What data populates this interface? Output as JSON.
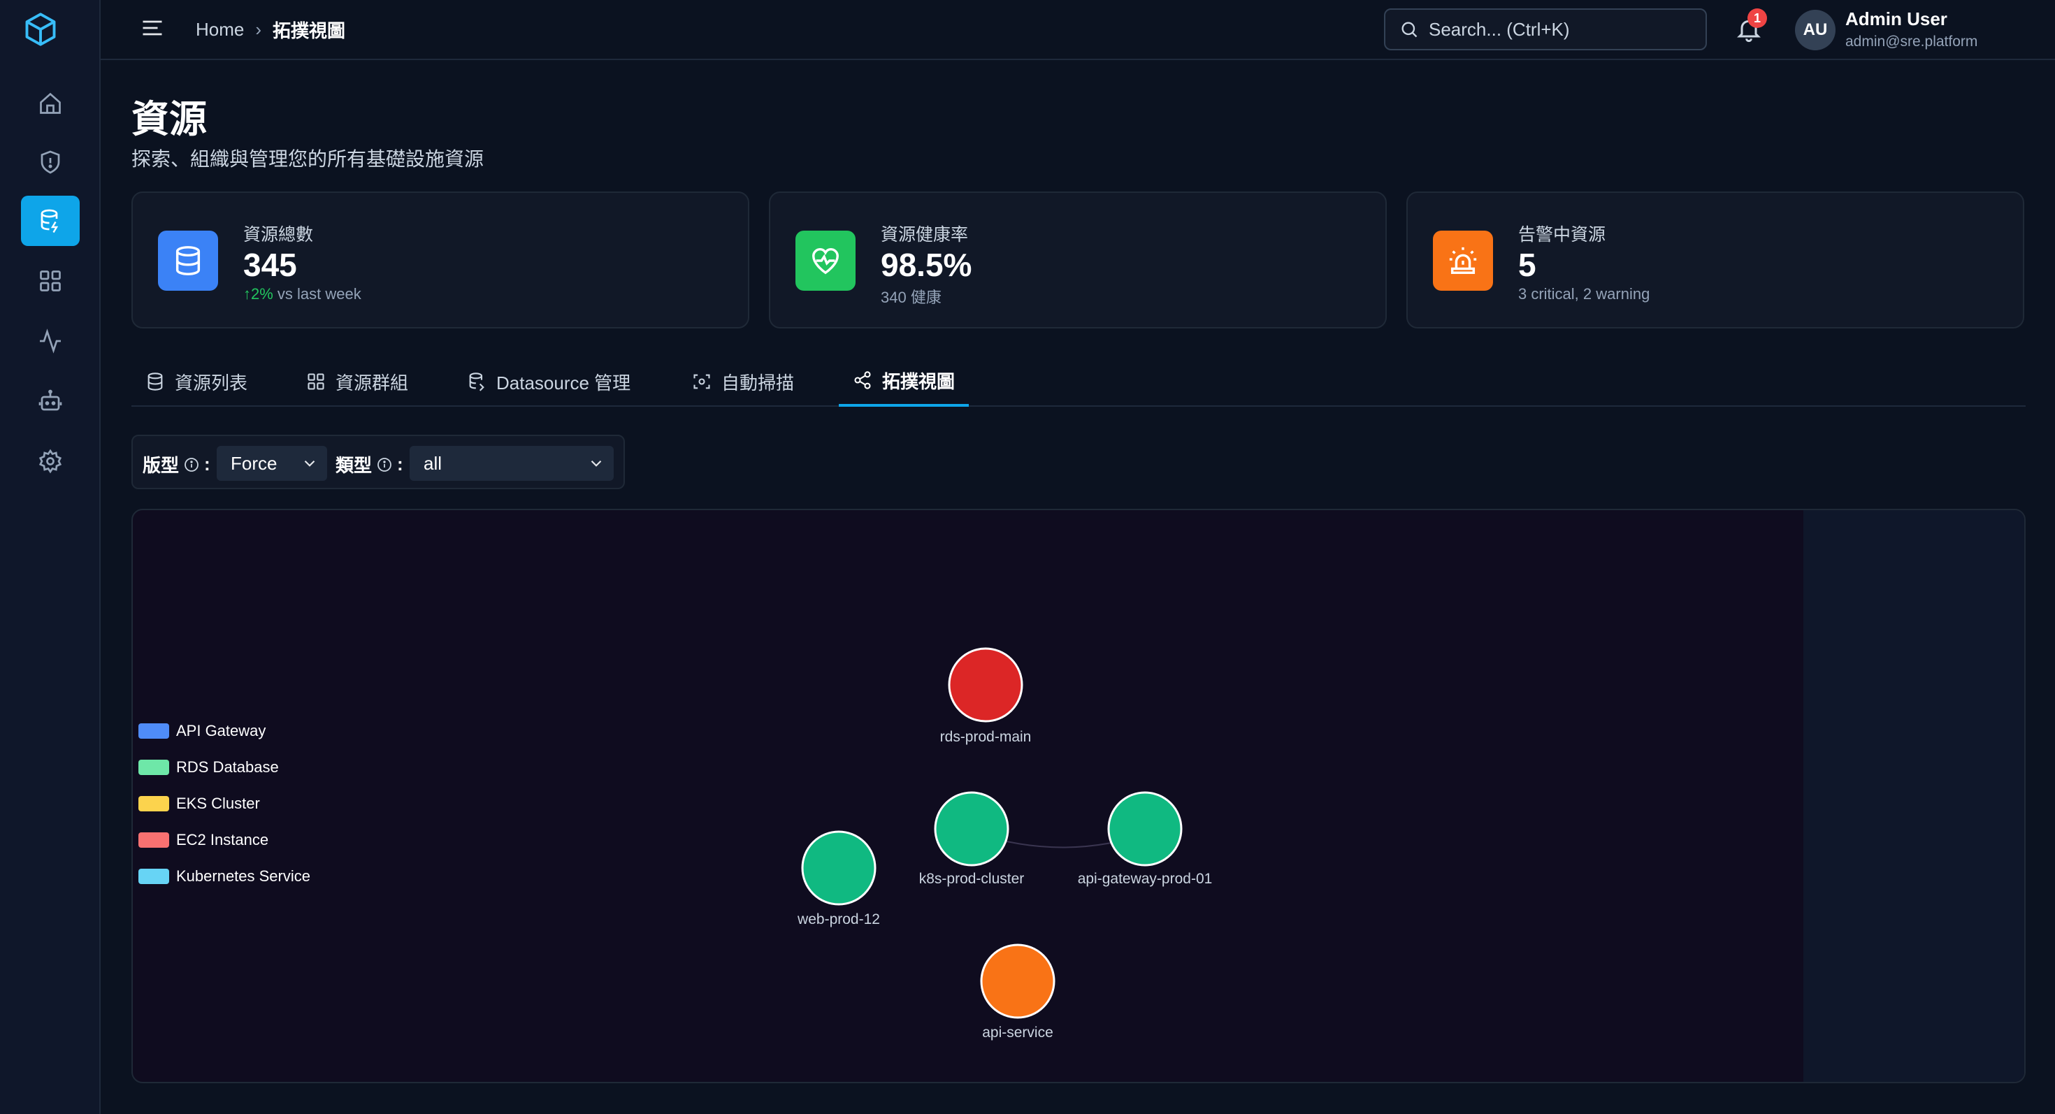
{
  "header": {
    "breadcrumb": [
      "Home",
      "拓撲視圖"
    ],
    "search_placeholder": "Search... (Ctrl+K)",
    "notification_count": "1",
    "user": {
      "initials": "AU",
      "name": "Admin User",
      "email": "admin@sre.platform"
    }
  },
  "page": {
    "title": "資源",
    "subtitle": "探索、組織與管理您的所有基礎設施資源"
  },
  "stats": [
    {
      "label": "資源總數",
      "value": "345",
      "trend": "↑2%",
      "sub": " vs last week",
      "color": "#3b82f6",
      "icon": "database-icon"
    },
    {
      "label": "資源健康率",
      "value": "98.5%",
      "sub": "340 健康",
      "color": "#22c55e",
      "icon": "heart-pulse-icon"
    },
    {
      "label": "告警中資源",
      "value": "5",
      "sub": "3 critical, 2 warning",
      "color": "#f97316",
      "icon": "alarm-icon"
    }
  ],
  "tabs": [
    {
      "label": "資源列表",
      "icon": "database-icon"
    },
    {
      "label": "資源群組",
      "icon": "grid-icon"
    },
    {
      "label": "Datasource 管理",
      "icon": "datasource-icon"
    },
    {
      "label": "自動掃描",
      "icon": "scan-icon"
    },
    {
      "label": "拓撲視圖",
      "icon": "share-icon",
      "active": true
    }
  ],
  "filters": {
    "layout_label": "版型",
    "layout_value": "Force",
    "type_label": "類型",
    "type_value": "all",
    "colon": ":"
  },
  "legend": [
    {
      "label": "API Gateway",
      "color": "#4f8cf7"
    },
    {
      "label": "RDS Database",
      "color": "#6ee7a8"
    },
    {
      "label": "EKS Cluster",
      "color": "#fcd34d"
    },
    {
      "label": "EC2 Instance",
      "color": "#f87171"
    },
    {
      "label": "Kubernetes Service",
      "color": "#67d4f5"
    }
  ],
  "nodes": [
    {
      "name": "rds-prod-main",
      "color": "#dc2626"
    },
    {
      "name": "k8s-prod-cluster",
      "color": "#10b981"
    },
    {
      "name": "api-gateway-prod-01",
      "color": "#10b981"
    },
    {
      "name": "web-prod-12",
      "color": "#10b981"
    },
    {
      "name": "api-service",
      "color": "#f97316"
    }
  ]
}
